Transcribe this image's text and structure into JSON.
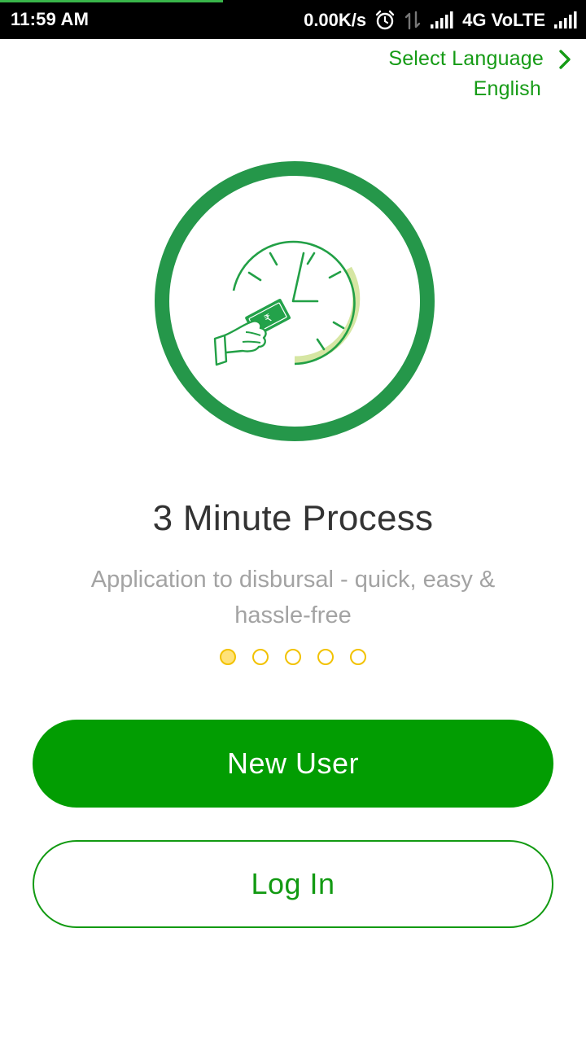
{
  "status_bar": {
    "time": "11:59 AM",
    "net_speed": "0.00K/s",
    "network": "4G VoLTE",
    "download_progress_fraction": 0.38,
    "icons": [
      "alarm-icon",
      "data-transfer-icon",
      "signal-icon",
      "signal-icon"
    ]
  },
  "language": {
    "label": "Select Language",
    "current": "English",
    "icon": "chevron-right-icon"
  },
  "onboarding": {
    "illustration": "clock-cash-hand-icon",
    "title": "3 Minute Process",
    "description": "Application to disbursal - quick, easy & hassle-free",
    "page_count": 5,
    "active_page": 1
  },
  "actions": {
    "new_user_label": "New User",
    "login_label": "Log In"
  },
  "colors": {
    "brand_green": "#029d02",
    "ring_green": "#25974a",
    "dot_yellow": "#f2c200",
    "text_dark": "#333333",
    "text_muted": "#a3a3a3"
  }
}
